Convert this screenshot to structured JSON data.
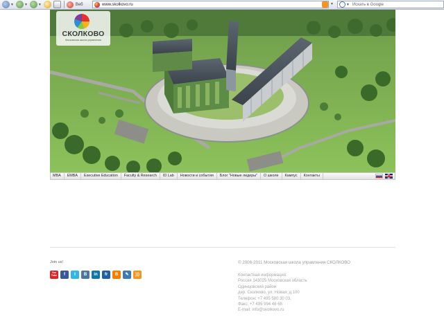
{
  "browser": {
    "web_label": "Веб",
    "url": "www.skolkovo.ru",
    "search_placeholder": "Искать в Google"
  },
  "logo": {
    "name": "СКОЛКОВО",
    "subtitle": "Московская школа управления"
  },
  "menu": [
    "MBA",
    "EMBA",
    "Executive Education",
    "Faculty & Research",
    "ID Lab",
    "Новости и события",
    "Блог \"Новые лидеры\"",
    "О школе",
    "Кампус",
    "Контакты"
  ],
  "languages": [
    "ru-flag-icon",
    "uk-flag-icon"
  ],
  "footer": {
    "join_label": "Join us!",
    "socials": [
      {
        "name": "youtube-icon",
        "glyph": "You\nTube",
        "color": "#d9252a"
      },
      {
        "name": "facebook-icon",
        "glyph": "f",
        "color": "#3b5998"
      },
      {
        "name": "twitter-icon",
        "glyph": "t",
        "color": "#33b5e5"
      },
      {
        "name": "vkontakte-icon",
        "glyph": "В",
        "color": "#4c75a3"
      },
      {
        "name": "linkedin-icon",
        "glyph": "in",
        "color": "#0e76a8"
      },
      {
        "name": "friendfeed-icon",
        "glyph": "fr",
        "color": "#1f5fa8"
      },
      {
        "name": "blogger-icon",
        "glyph": "B",
        "color": "#f57d00"
      },
      {
        "name": "livejournal-icon",
        "glyph": "✎",
        "color": "#3d7ab8"
      },
      {
        "name": "rss-icon",
        "glyph": ")))",
        "color": "#f7931e"
      }
    ],
    "copyright": "© 2006-2011 Московская школа управления СКОЛКОВО",
    "contacts": [
      "Контактная информация:",
      "Россия 143025 Московская область",
      "Одинцовский район",
      "дер. Сколково, ул. Новая, д.100",
      "Телефон: +7 495 580 30 03,",
      "Факс: +7 495 994 46 68",
      "E-mail: info@skolkovo.ru"
    ]
  }
}
